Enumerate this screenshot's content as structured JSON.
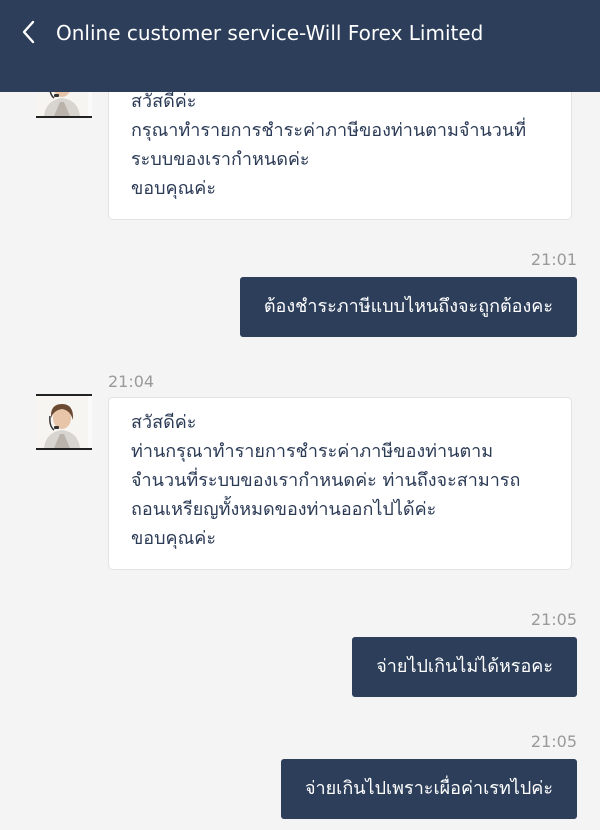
{
  "header": {
    "title": "Online customer service-Will Forex Limited",
    "back_icon": "chevron-left-icon",
    "background": "#2c3e5a"
  },
  "messages": [
    {
      "direction": "incoming",
      "sender_avatar": "agent-avatar",
      "lines": [
        "สวัสดีค่ะ",
        "กรุณาทำรายการชำระค่าภาษีของท่านตามจำนวนที่",
        "ระบบของเรากำหนดค่ะ",
        "ขอบคุณค่ะ"
      ]
    },
    {
      "direction": "outgoing",
      "time": "21:01",
      "text": "ต้องชำระภาษีแบบไหนถึงจะถูกต้องคะ"
    },
    {
      "direction": "incoming",
      "time": "21:04",
      "sender_avatar": "agent-avatar",
      "lines": [
        "สวัสดีค่ะ",
        "ท่านกรุณาทำรายการชำระค่าภาษีของท่านตาม",
        "จำนวนที่ระบบของเรากำหนดค่ะ ท่านถึงจะสามารถ",
        "ถอนเหรียญทั้งหมดของท่านออกไปได้ค่ะ",
        "ขอบคุณค่ะ"
      ]
    },
    {
      "direction": "outgoing",
      "time": "21:05",
      "text": "จ่ายไปเกินไม่ได้หรอคะ"
    },
    {
      "direction": "outgoing",
      "time": "21:05",
      "text": "จ่ายเกินไปเพราะเผื่อค่าเรทไปค่ะ"
    }
  ],
  "colors": {
    "accent": "#2c3e5a",
    "chat_background": "#f4f4f4",
    "incoming_text": "#2b3a55",
    "timestamp": "#9a9a9a"
  }
}
